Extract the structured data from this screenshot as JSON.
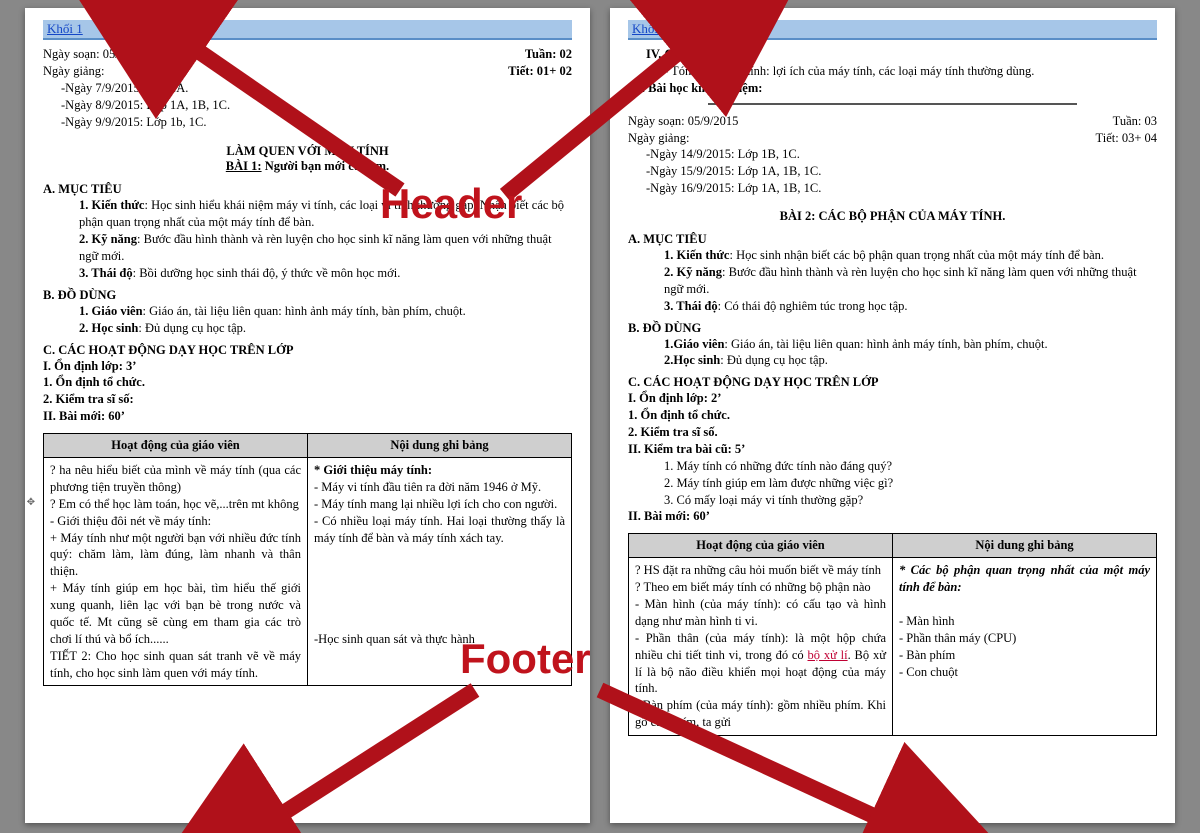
{
  "annotations": {
    "header_label": "Header",
    "footer_label": "Footer"
  },
  "header": {
    "text": "Khối 1"
  },
  "page1": {
    "date_line": "Ngày soạn: 05/9/2015",
    "week": "Tuần: 02",
    "teach_line": "Ngày giảng:",
    "period": "Tiết: 01+ 02",
    "days": [
      "-Ngày 7/9/2015: Lớp 1A.",
      "-Ngày 8/9/2015: Lớp 1A, 1B, 1C.",
      "-Ngày 9/9/2015: Lớp 1b, 1C."
    ],
    "title_top": "LÀM QUEN VỚI MÁY TÍNH",
    "title_sub_prefix": "BÀI 1:",
    "title_sub": "Người bạn mới của em.",
    "A": "A. MỤC TIÊU",
    "A1a": "1. Kiến thức",
    "A1b": ": Học sinh hiểu khái niệm máy vi tính, các loại vi tính thường gặp. Nhận biết các bộ phận quan trọng nhất của một máy tính để bàn.",
    "A2a": "2. Kỹ năng",
    "A2b": ": Bước đầu hình thành và rèn luyện cho học sinh kĩ năng làm quen với những thuật ngữ mới.",
    "A3a": "3. Thái độ",
    "A3b": ": Bồi dưỡng học sinh thái độ, ý thức về môn học mới.",
    "B": "B. ĐỒ DÙNG",
    "B1a": "1. Giáo viên",
    "B1b": ": Giáo án, tài liệu liên quan: hình ảnh máy tính, bàn phím, chuột.",
    "B2a": "2. Học sinh",
    "B2b": ": Đủ dụng cụ học tập.",
    "C": "C. CÁC HOẠT ĐỘNG DẠY HỌC TRÊN LỚP",
    "C_I": "I. Ổn định lớp: 3’",
    "C1": "1. Ổn định tổ chức.",
    "C2": "2. Kiểm tra sĩ số:",
    "C_II": "II. Bài mới: 60’",
    "table": {
      "h1": "Hoạt động của giáo viên",
      "h2": "Nội dung ghi bảng",
      "col1": "? ha nêu hiểu biết của mình về máy tính (qua các phương tiện truyền thông)\n? Em có thể học làm toán, học vẽ,...trên mt không\n- Giới thiệu đôi nét về máy tính:\n+ Máy tính như một người bạn với nhiều đức tính quý: chăm làm, làm đúng, làm nhanh và thân thiện.\n+ Máy tính giúp em học bài, tìm hiểu thế giới xung quanh, liên lạc với bạn bè trong nước và quốc tế. Mt cũng sẽ cùng em tham gia các trò chơi lí thú và bổ ích......\n TIẾT 2: Cho học sinh quan sát tranh vẽ về máy tính, cho học sinh làm quen với máy tính.",
      "col2_title": "* Giới thiệu máy tính:",
      "col2_b1": "- Máy vi tính đầu tiên ra đời năm 1946 ở Mỹ.",
      "col2_b2": "- Máy tính mang lại nhiều lợi ích cho con người.",
      "col2_b3": "- Có nhiều loại máy tính. Hai loại thường thấy là máy tính để bàn và máy tính xách tay.",
      "col2_b4": "-Học sinh quan sát và thực hành"
    }
  },
  "page2": {
    "IV": "IV. Củng cố: 5’",
    "IV_1": "- Tóm tắt lại ý chính: lợi ích của máy tính, các loại máy tính thường dùng.",
    "VI": "VI. Bài học kinh nghiệm:",
    "date_line": "Ngày soạn: 05/9/2015",
    "week": "Tuần:   03",
    "teach_line": "Ngày giảng:",
    "period": "Tiết: 03+ 04",
    "days": [
      "-Ngày 14/9/2015: Lớp 1B, 1C.",
      "-Ngày 15/9/2015: Lớp 1A, 1B, 1C.",
      "-Ngày 16/9/2015: Lớp 1A, 1B, 1C."
    ],
    "title": "BÀI 2: CÁC BỘ PHẬN CỦA MÁY TÍNH.",
    "A": "A. MỤC TIÊU",
    "A1a": "1. Kiến thức",
    "A1b": ": Học sinh nhận biết các bộ phận quan trọng nhất của một máy tính để bàn.",
    "A2a": "2. Kỹ năng",
    "A2b": ": Bước đầu hình thành và rèn luyện cho học sinh kĩ năng làm quen với những thuật ngữ mới.",
    "A3a": "3. Thái độ",
    "A3b": ": Có thái độ nghiêm túc trong học tập.",
    "B": "B. ĐỒ DÙNG",
    "B1a": "1.Giáo viên",
    "B1b": ": Giáo án, tài liệu liên quan: hình ảnh máy tính, bàn phím, chuột.",
    "B2a": "2.Học sinh",
    "B2b": ": Đủ dụng cụ học tập.",
    "C": "C. CÁC HOẠT ĐỘNG DẠY HỌC TRÊN LỚP",
    "C_I": "I. Ổn định lớp: 2’",
    "C1": "1. Ổn định tổ chức.",
    "C2": "2. Kiểm tra sĩ số.",
    "C_II": "II. Kiểm tra bài cũ: 5’",
    "q1": "1.  Máy tính có những đức tính nào đáng quý?",
    "q2": "2.  Máy tính giúp em làm được những việc gì?",
    "q3": "3.  Có mấy loại máy vi tính thường gặp?",
    "C_III": "II. Bài mới: 60’",
    "table": {
      "h1": "Hoạt động của giáo viên",
      "h2": "Nội dung ghi bảng",
      "col1_pre": "? HS đặt ra những câu hỏi muốn biết về máy tính\n? Theo em biết máy tính có những bộ phận nào\n- Màn hình (của máy tính): có cấu tạo và hình dạng như màn hình ti vi.\n- Phần thân (của máy tính):  là một hộp chứa nhiều chi tiết tinh vi, trong đó có ",
      "col1_red": "bộ xử lí",
      "col1_post": ". Bộ xử lí là bộ não điều khiển mọi hoạt động của máy tính.\n- Bàn phím  (của máy tính): gồm nhiều phím. Khi gõ các phím, ta gửi",
      "col2_title": "* Các bộ phận quan trọng nhất của một máy tính để bàn:",
      "col2_b1": "- Màn hình",
      "col2_b2": "- Phần thân máy (CPU)",
      "col2_b3": "- Bàn phím",
      "col2_b4": "- Con chuột"
    }
  }
}
